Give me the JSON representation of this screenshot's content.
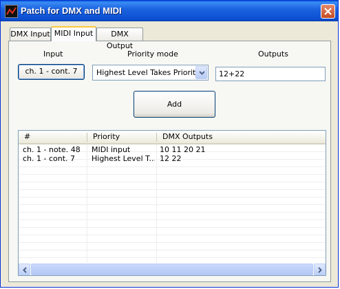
{
  "window": {
    "title": "Patch for DMX and MIDI"
  },
  "tabs": [
    {
      "label": "DMX Input",
      "active": false
    },
    {
      "label": "MIDI Input",
      "active": true
    },
    {
      "label": "DMX Output",
      "active": false
    }
  ],
  "form": {
    "input_label": "Input",
    "input_button": "ch. 1 - cont. 7",
    "priority_label": "Priority mode",
    "priority_value": "Highest Level Takes Priority",
    "outputs_label": "Outputs",
    "outputs_value": "12+22",
    "add_button": "Add"
  },
  "list": {
    "columns": [
      "#",
      "Priority",
      "DMX Outputs"
    ],
    "rows": [
      {
        "num": "ch. 1 - note. 48",
        "priority": "MIDI input",
        "outputs": "10 11 20 21"
      },
      {
        "num": "ch. 1 - cont. 7",
        "priority": "Highest Level T...",
        "outputs": "12 22"
      }
    ]
  },
  "colors": {
    "title_bar": "#0a5fd8",
    "tab_highlight": "#ffc83c",
    "panel": "#ece9d8"
  },
  "icons": {
    "app": "dmx-patch-app-icon",
    "close": "close-icon",
    "dropdown": "chevron-down-icon"
  }
}
